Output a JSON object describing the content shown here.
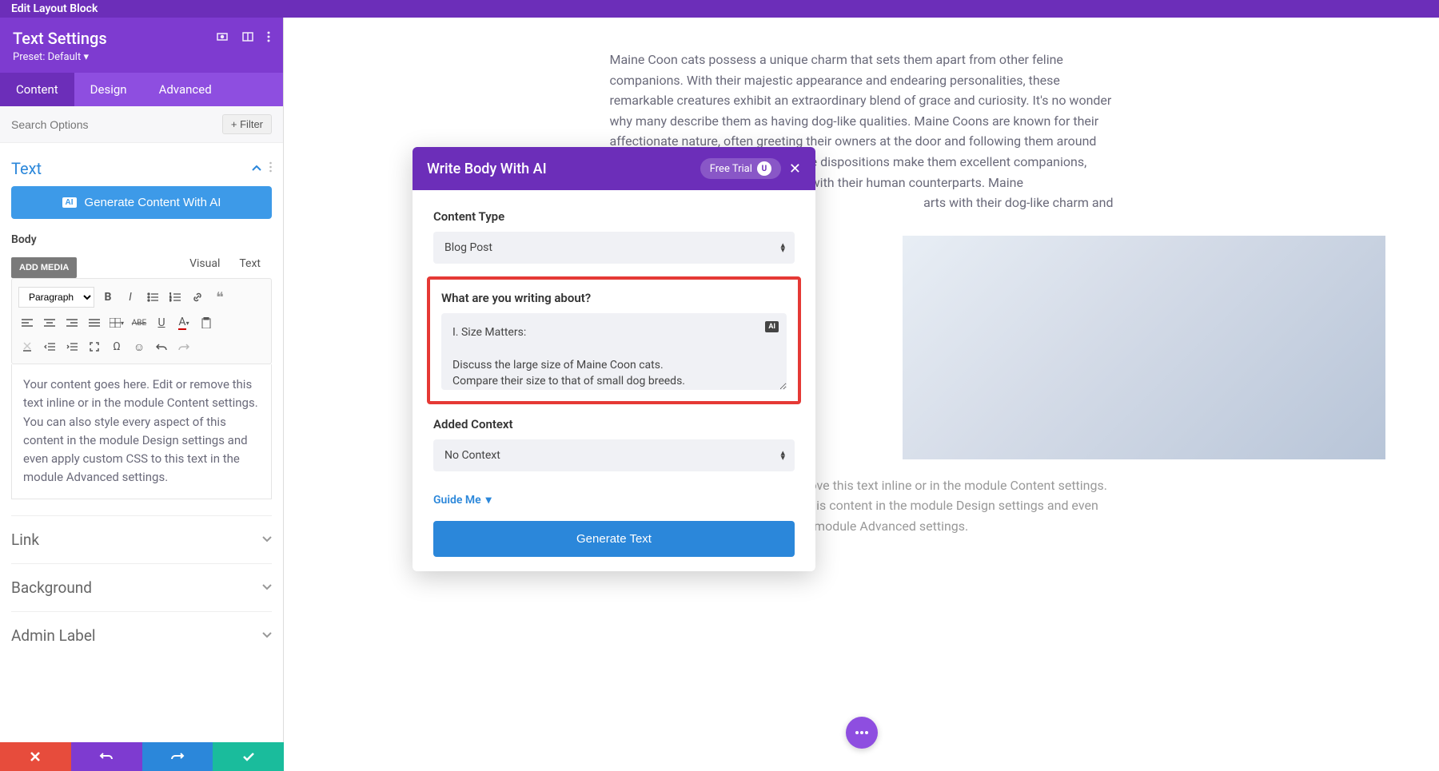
{
  "topbar": {
    "title": "Edit Layout Block"
  },
  "settings": {
    "title": "Text Settings",
    "preset": "Preset: Default"
  },
  "tabs": [
    "Content",
    "Design",
    "Advanced"
  ],
  "search": {
    "placeholder": "Search Options",
    "filter": "Filter"
  },
  "text_section": {
    "title": "Text",
    "generate_btn": "Generate Content With AI",
    "body_label": "Body",
    "add_media": "ADD MEDIA",
    "editor_tabs": [
      "Visual",
      "Text"
    ],
    "format_select": "Paragraph",
    "placeholder": "Your content goes here. Edit or remove this text inline or in the module Content settings. You can also style every aspect of this content in the module Design settings and even apply custom CSS to this text in the module Advanced settings."
  },
  "accordions": [
    "Link",
    "Background",
    "Admin Label"
  ],
  "canvas": {
    "body": "Maine Coon cats possess a unique charm that sets them apart from other feline companions. With their majestic appearance and endearing personalities, these remarkable creatures exhibit an extraordinary blend of grace and curiosity. It's no wonder why many describe them as having dog-like qualities. Maine Coons are known for their affectionate nature, often greeting their owners at the door and following them around the house. Their playful and sociable dispositions make them excellent companions, eagerly initiating interactive games with their human counterparts. Maine",
    "body_cont": "arts with their dog-like charm and",
    "below_placeholder": "Your content goes here. Edit or remove this text inline or in the module Content settings. You can also style every aspect of this content in the module Design settings and even apply custom CSS to this text in the module Advanced settings."
  },
  "modal": {
    "title": "Write Body With AI",
    "free_trial": "Free Trial",
    "avatar": "U",
    "content_type_label": "Content Type",
    "content_type_value": "Blog Post",
    "prompt_label": "What are you writing about?",
    "prompt_value": "I. Size Matters:\n\nDiscuss the large size of Maine Coon cats.\nCompare their size to that of small dog breeds.\nExplain how their substantial size contributes to their dog-like",
    "context_label": "Added Context",
    "context_value": "No Context",
    "guide": "Guide Me",
    "generate": "Generate Text"
  }
}
